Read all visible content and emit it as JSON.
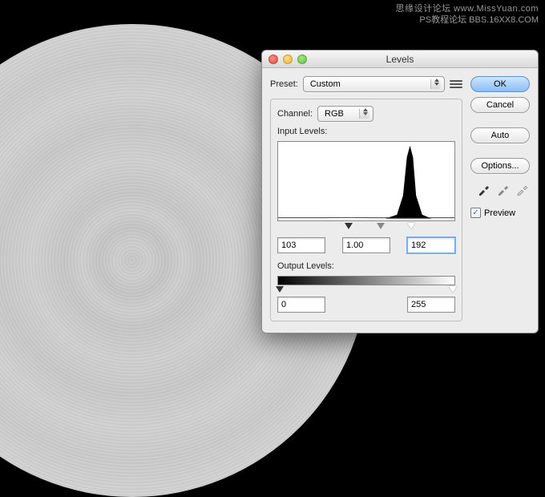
{
  "watermark": {
    "line1": "思缘设计论坛  www.MissYuan.com",
    "line2": "PS教程论坛",
    "line3": "BBS.16XX8.COM"
  },
  "dialog": {
    "title": "Levels",
    "preset_label": "Preset:",
    "preset_value": "Custom",
    "channel_label": "Channel:",
    "channel_value": "RGB",
    "input_levels_label": "Input Levels:",
    "output_levels_label": "Output Levels:",
    "input": {
      "shadow": "103",
      "mid": "1.00",
      "highlight": "192"
    },
    "output": {
      "low": "0",
      "high": "255"
    },
    "buttons": {
      "ok": "OK",
      "cancel": "Cancel",
      "auto": "Auto",
      "options": "Options..."
    },
    "preview_label": "Preview",
    "preview_checked": true
  },
  "colors": {
    "accent": "#8cbef5"
  }
}
